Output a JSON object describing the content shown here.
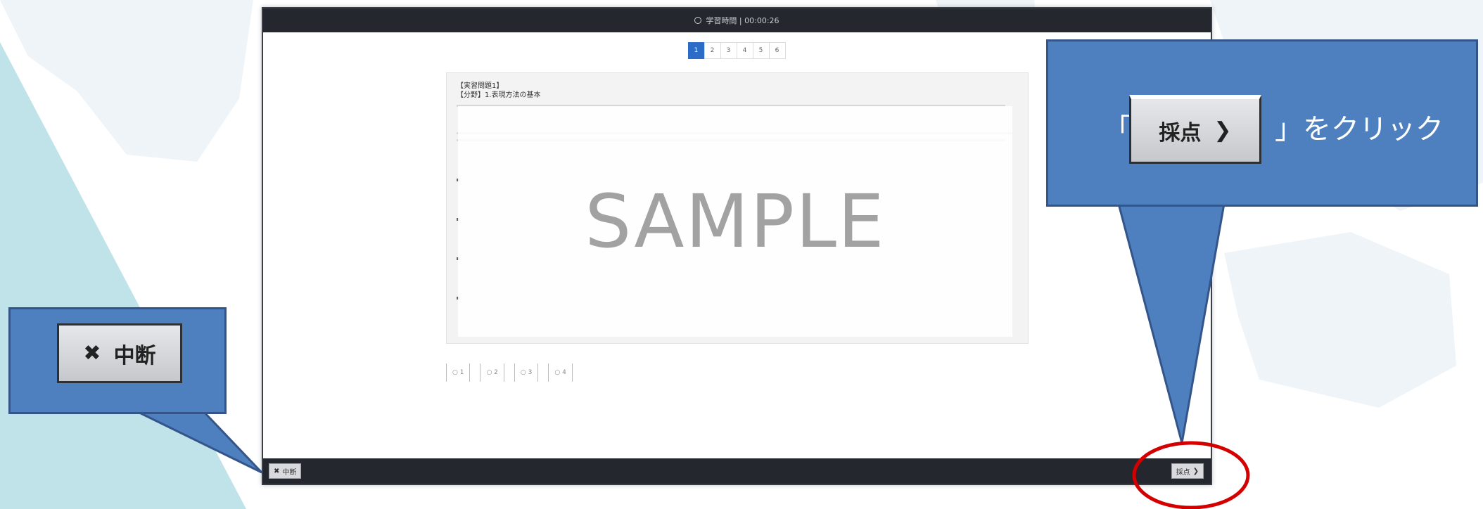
{
  "app": {
    "header_title": "学習時間 | 00:00:26",
    "pagination": [
      "1",
      "2",
      "3",
      "4",
      "5",
      "6"
    ],
    "active_page": "1",
    "question": {
      "heading_1": "【実習問題1】",
      "heading_2": "【分野】1.表現方法の基本"
    },
    "sample_watermark": "SAMPLE",
    "answer_choices": [
      "○ 1",
      "○ 2",
      "○ 3",
      "○ 4"
    ],
    "footer": {
      "interrupt_label": "中断",
      "score_label": "採点"
    }
  },
  "callouts": {
    "interrupt_button_label": "中断",
    "score_prefix": "「",
    "score_button_label": "採点",
    "score_suffix": "」をクリック"
  },
  "colors": {
    "callout_fill": "#4e7fbf",
    "highlight_ring": "#d40000",
    "header_bg": "#24282e",
    "active_page": "#2c6cc6"
  },
  "icons": {
    "interrupt": "close-x-icon",
    "score": "chevron-right-icon",
    "timer": "clock-icon"
  }
}
